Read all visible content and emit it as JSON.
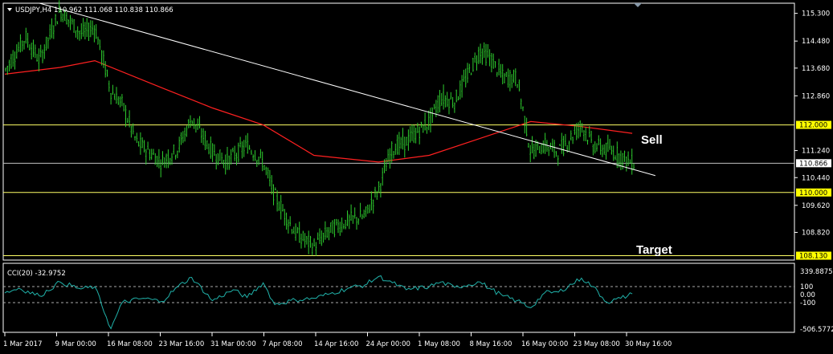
{
  "header": {
    "menu_icon": "triangle-down-icon",
    "text": "USDJPY,H4  110.962 111.068 110.838 110.866"
  },
  "indicator": {
    "label": "CCI(20) -32.9752",
    "scale_top": "339.8875",
    "scale_bottom": "-506.5772",
    "levels": [
      "100",
      "0.00",
      "-100"
    ]
  },
  "annotations": {
    "sell": "Sell",
    "target": "Target"
  },
  "colors": {
    "background": "#000000",
    "candles": "#2ecc2e",
    "moving_average": "#ff2020",
    "trendline": "#ffffff",
    "level_line": "#ffff66",
    "price_line": "#c0c0c0",
    "cci_line": "#20b2aa",
    "tag_yellow": "#ffff00"
  },
  "chart_data": [
    {
      "type": "candlestick",
      "symbol": "USDJPY",
      "timeframe": "H4",
      "ohlc_last": {
        "open": 110.962,
        "high": 111.068,
        "low": 110.838,
        "close": 110.866
      },
      "ylim": [
        108.0,
        115.6
      ],
      "y_ticks": [
        "115.300",
        "114.480",
        "113.680",
        "112.860",
        "111.240",
        "110.440",
        "109.620",
        "108.820"
      ],
      "x_ticks": [
        "1 Mar 2017",
        "9 Mar 00:00",
        "16 Mar 08:00",
        "23 Mar 16:00",
        "31 Mar 00:00",
        "7 Apr 08:00",
        "14 Apr 16:00",
        "24 Apr 00:00",
        "1 May 08:00",
        "8 May 16:00",
        "16 May 00:00",
        "23 May 08:00",
        "30 May 16:00"
      ],
      "price_path": [
        [
          "1 Mar 2017",
          113.6
        ],
        [
          "4 Mar",
          114.6
        ],
        [
          "6 Mar",
          113.9
        ],
        [
          "9 Mar 00:00",
          115.4
        ],
        [
          "12 Mar",
          114.7
        ],
        [
          "14 Mar",
          114.9
        ],
        [
          "16 Mar 08:00",
          113.0
        ],
        [
          "18 Mar",
          112.6
        ],
        [
          "20 Mar",
          111.5
        ],
        [
          "23 Mar 16:00",
          110.9
        ],
        [
          "26 Mar",
          111.3
        ],
        [
          "28 Mar",
          112.2
        ],
        [
          "31 Mar 00:00",
          111.2
        ],
        [
          "2 Apr",
          110.9
        ],
        [
          "5 Apr",
          111.4
        ],
        [
          "7 Apr 08:00",
          110.9
        ],
        [
          "9 Apr",
          109.9
        ],
        [
          "12 Apr",
          108.8
        ],
        [
          "14 Apr 16:00",
          108.4
        ],
        [
          "17 Apr",
          108.9
        ],
        [
          "20 Apr",
          109.2
        ],
        [
          "22 Apr",
          109.3
        ],
        [
          "24 Apr 00:00",
          110.1
        ],
        [
          "26 Apr",
          111.3
        ],
        [
          "28 Apr",
          111.5
        ],
        [
          "1 May 08:00",
          112.1
        ],
        [
          "3 May",
          112.8
        ],
        [
          "5 May",
          112.7
        ],
        [
          "8 May 16:00",
          114.2
        ],
        [
          "10 May",
          114.0
        ],
        [
          "12 May",
          113.4
        ],
        [
          "14 May",
          113.4
        ],
        [
          "16 May 00:00",
          111.2
        ],
        [
          "18 May",
          111.4
        ],
        [
          "20 May",
          111.2
        ],
        [
          "23 May 08:00",
          112.0
        ],
        [
          "25 May",
          111.4
        ],
        [
          "28 May",
          111.2
        ],
        [
          "30 May 16:00",
          110.866
        ]
      ],
      "moving_average_path": [
        [
          "1 Mar 2017",
          113.5
        ],
        [
          "9 Mar 00:00",
          113.7
        ],
        [
          "14 Mar",
          113.9
        ],
        [
          "23 Mar 16:00",
          113.1
        ],
        [
          "31 Mar 00:00",
          112.5
        ],
        [
          "7 Apr 08:00",
          112.0
        ],
        [
          "14 Apr 16:00",
          111.1
        ],
        [
          "24 Apr 00:00",
          110.9
        ],
        [
          "1 May 08:00",
          111.1
        ],
        [
          "8 May 16:00",
          111.6
        ],
        [
          "16 May 00:00",
          112.1
        ],
        [
          "23 May 08:00",
          111.95
        ],
        [
          "30 May 16:00",
          111.75
        ]
      ],
      "trendline": {
        "from": [
          "6 Mar",
          115.6
        ],
        "to": [
          "3 Jun",
          110.5
        ]
      },
      "horizontal_levels": [
        {
          "value": 112.0,
          "label": "112.000",
          "style": "yellow"
        },
        {
          "value": 110.866,
          "label": "110.866",
          "style": "price"
        },
        {
          "value": 110.0,
          "label": "110.000",
          "style": "yellow"
        },
        {
          "value": 108.13,
          "label": "108.130",
          "style": "yellow"
        }
      ]
    },
    {
      "type": "line",
      "name": "CCI(20)",
      "ylim": [
        -506.5772,
        339.8875
      ],
      "y_ticks": [
        "339.8875",
        "100",
        "0.00",
        "-100",
        "-506.5772"
      ],
      "levels": [
        100,
        -100
      ],
      "points": [
        [
          "1 Mar 2017",
          -20
        ],
        [
          "3 Mar",
          40
        ],
        [
          "6 Mar",
          -60
        ],
        [
          "9 Mar 00:00",
          120
        ],
        [
          "12 Mar",
          30
        ],
        [
          "14 Mar",
          60
        ],
        [
          "16 Mar 08:00",
          -480
        ],
        [
          "18 Mar",
          -140
        ],
        [
          "21 Mar",
          -90
        ],
        [
          "23 Mar 16:00",
          -130
        ],
        [
          "26 Mar",
          60
        ],
        [
          "28 Mar",
          180
        ],
        [
          "31 Mar 00:00",
          -120
        ],
        [
          "3 Apr",
          20
        ],
        [
          "5 Apr",
          -80
        ],
        [
          "7 Apr 08:00",
          110
        ],
        [
          "9 Apr",
          -170
        ],
        [
          "12 Apr",
          -110
        ],
        [
          "14 Apr 16:00",
          -90
        ],
        [
          "17 Apr",
          -30
        ],
        [
          "20 Apr",
          50
        ],
        [
          "22 Apr",
          80
        ],
        [
          "24 Apr 00:00",
          190
        ],
        [
          "26 Apr",
          110
        ],
        [
          "28 Apr",
          20
        ],
        [
          "1 May 08:00",
          60
        ],
        [
          "3 May",
          120
        ],
        [
          "5 May",
          50
        ],
        [
          "8 May 16:00",
          120
        ],
        [
          "10 May",
          40
        ],
        [
          "12 May",
          -60
        ],
        [
          "14 May",
          -120
        ],
        [
          "16 May 00:00",
          -210
        ],
        [
          "18 May",
          -20
        ],
        [
          "20 May",
          -10
        ],
        [
          "23 May 08:00",
          170
        ],
        [
          "25 May",
          60
        ],
        [
          "27 May",
          -140
        ],
        [
          "29 May",
          -90
        ],
        [
          "30 May 16:00",
          -32.9752
        ]
      ]
    }
  ]
}
